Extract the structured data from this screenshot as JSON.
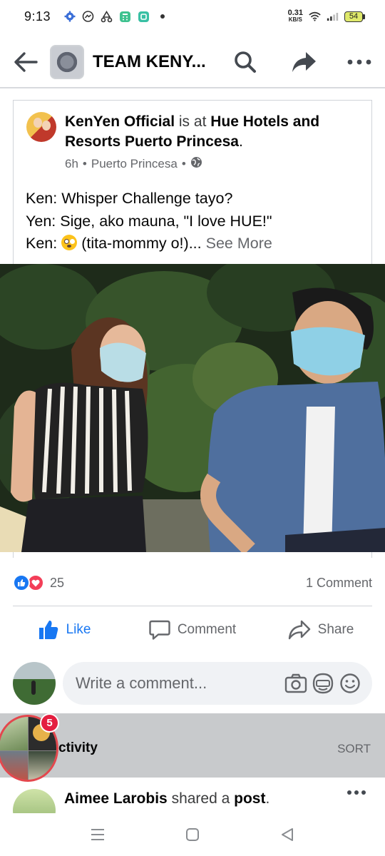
{
  "status_bar": {
    "time": "9:13",
    "net_speed": "0.31",
    "net_unit": "KB/S",
    "battery": "54",
    "icons": [
      "settings-gear-icon",
      "messenger-icon",
      "recycle-icon",
      "calculator-icon",
      "app-square-icon",
      "dot-icon",
      "wifi-icon",
      "signal-icon",
      "battery-icon"
    ]
  },
  "header": {
    "title": "TEAM KENY...",
    "icons": [
      "back-arrow-icon",
      "search-icon",
      "share-arrow-icon",
      "more-dots-icon"
    ]
  },
  "post": {
    "author": "KenYen Official",
    "is_at": "is at",
    "place": "Hue Hotels and Resorts Puerto Princesa",
    "period": ".",
    "time": "6h",
    "location": "Puerto Princesa",
    "sep": "•",
    "lines": [
      "Ken: Whisper Challenge tayo?",
      "Yen: Sige, ako mauna, \"I love HUE!\"",
      "Ken:"
    ],
    "line3_rest": " (tita-mommy o!)...",
    "see_more": "See More"
  },
  "reactions": {
    "count": "25",
    "comments": "1 Comment",
    "types": [
      "like",
      "love"
    ]
  },
  "actions": {
    "like": "Like",
    "comment": "Comment",
    "share": "Share"
  },
  "comment_box": {
    "placeholder": "Write a comment..."
  },
  "activity": {
    "label": "ctivity",
    "sort": "SORT",
    "chat_badge": "5"
  },
  "next_item": {
    "name": "Aimee Larobis",
    "verb": "shared a",
    "object": "post",
    "period": "."
  },
  "colors": {
    "accent": "#1877f2",
    "love": "#f33e58",
    "muted": "#65676b",
    "badge": "#e41e3f"
  }
}
